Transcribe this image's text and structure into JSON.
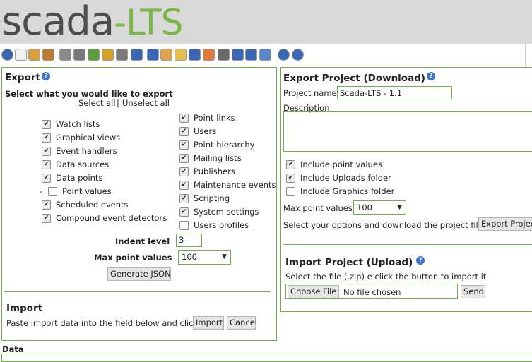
{
  "logo": {
    "part1": "scada",
    "part2": "-LTS"
  },
  "toolbar": {
    "icons": [
      "eye-icon",
      "page-icon",
      "pencil-icon",
      "list-icon",
      "gear-icon",
      "database-icon",
      "clock-icon",
      "flag-icon",
      "link-icon",
      "report-icon",
      "user-icon",
      "users-icon",
      "folder-icon",
      "document-icon",
      "wifi-icon",
      "wrench-icon",
      "settings-list-icon",
      "image-icon",
      "script-icon",
      "stop-icon",
      "help-icon"
    ]
  },
  "export": {
    "title": "Export",
    "instruction": "Select what you would like to export",
    "select_all": "Select all",
    "separator": "|",
    "unselect_all": "Unselect all",
    "left_items": [
      {
        "label": "Watch lists",
        "checked": true
      },
      {
        "label": "Graphical views",
        "checked": true
      },
      {
        "label": "Event handlers",
        "checked": true
      },
      {
        "label": "Data sources",
        "checked": true
      },
      {
        "label": "Data points",
        "checked": true
      },
      {
        "label": "Point values",
        "checked": false
      },
      {
        "label": "Scheduled events",
        "checked": true
      },
      {
        "label": "Compound event detectors",
        "checked": true
      }
    ],
    "point_values_prefix": "-",
    "right_items": [
      {
        "label": "Point links",
        "checked": true
      },
      {
        "label": "Users",
        "checked": true
      },
      {
        "label": "Point hierarchy",
        "checked": true
      },
      {
        "label": "Mailing lists",
        "checked": true
      },
      {
        "label": "Publishers",
        "checked": true
      },
      {
        "label": "Maintenance events",
        "checked": true
      },
      {
        "label": "Scripting",
        "checked": true
      },
      {
        "label": "System settings",
        "checked": true
      },
      {
        "label": "Users profiles",
        "checked": false
      }
    ],
    "indent_label": "Indent level",
    "indent_value": "3",
    "max_label": "Max point values",
    "max_value": "100",
    "generate_button": "Generate JSON"
  },
  "import": {
    "title": "Import",
    "instruction": "Paste import data into the field below and click",
    "import_button": "Import",
    "cancel_button": "Cancel"
  },
  "data": {
    "label": "Data"
  },
  "export_project": {
    "title": "Export Project (Download)",
    "name_label": "Project name",
    "name_value": "Scada-LTS - 1.1",
    "description_label": "Description",
    "options": [
      {
        "label": "Include point values",
        "checked": true
      },
      {
        "label": "Include Uploads folder",
        "checked": true
      },
      {
        "label": "Include Graphics folder",
        "checked": false
      }
    ],
    "max_label": "Max point values",
    "max_value": "100",
    "footer_text": "Select your options and download the project file",
    "export_button": "Export Project"
  },
  "import_project": {
    "title": "Import Project (Upload)",
    "instruction": "Select the file (.zip) e click the button to import it",
    "choose_button": "Choose File",
    "file_status": "No file chosen",
    "send_button": "Send"
  },
  "colors": {
    "accent": "#6cb33f",
    "logo_green": "#7ab845",
    "header_bg": "#d9d9d9",
    "help_blue": "#3b73d1"
  }
}
